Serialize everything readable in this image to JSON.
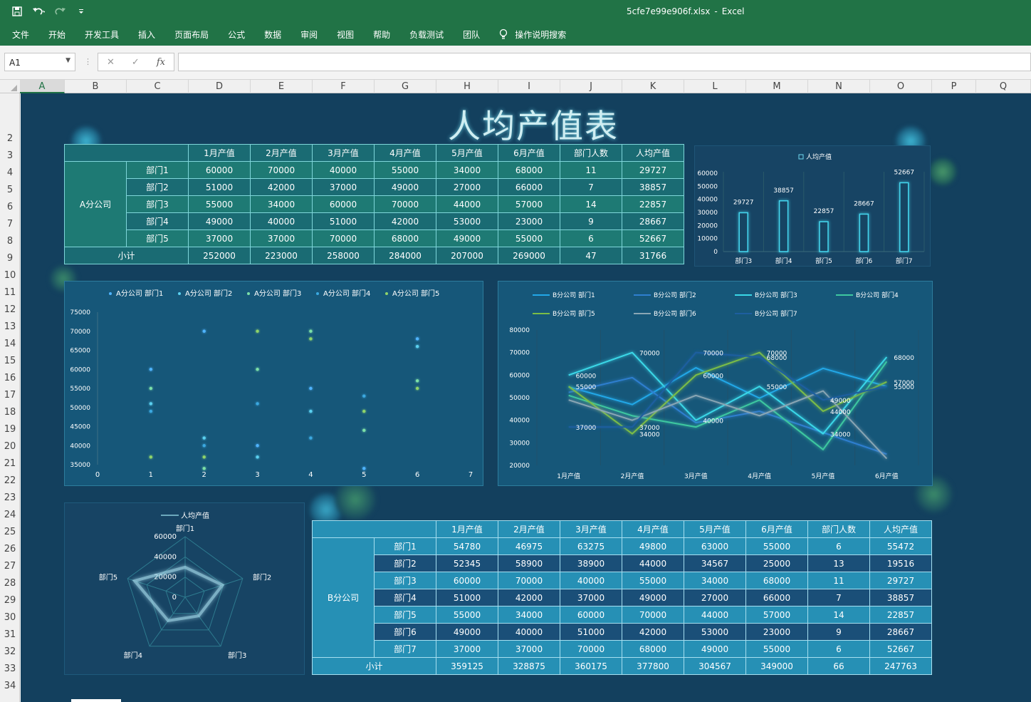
{
  "app": {
    "file": "5cfe7e99e906f.xlsx",
    "sep": "-",
    "name": "Excel"
  },
  "ribbon": [
    "文件",
    "开始",
    "开发工具",
    "插入",
    "页面布局",
    "公式",
    "数据",
    "审阅",
    "视图",
    "帮助",
    "负载测试",
    "团队"
  ],
  "search_label": "操作说明搜索",
  "name_box": "A1",
  "columns": [
    "A",
    "B",
    "C",
    "D",
    "E",
    "F",
    "G",
    "H",
    "I",
    "J",
    "K",
    "L",
    "M",
    "N",
    "O",
    "P",
    "Q"
  ],
  "rows": [
    "2",
    "3",
    "4",
    "5",
    "6",
    "7",
    "8",
    "9",
    "10",
    "11",
    "12",
    "13",
    "14",
    "15",
    "16",
    "17",
    "18",
    "19",
    "20",
    "21",
    "22",
    "23",
    "24",
    "25",
    "26",
    "27",
    "28",
    "29",
    "30",
    "31",
    "32",
    "33",
    "34"
  ],
  "title": "人均产值表",
  "table_a": {
    "headers": [
      "1月产值",
      "2月产值",
      "3月产值",
      "4月产值",
      "5月产值",
      "6月产值",
      "部门人数",
      "人均产值"
    ],
    "group": "A分公司",
    "rows": [
      {
        "dept": "部门1",
        "values": [
          "60000",
          "70000",
          "40000",
          "55000",
          "34000",
          "68000",
          "11",
          "29727"
        ]
      },
      {
        "dept": "部门2",
        "values": [
          "51000",
          "42000",
          "37000",
          "49000",
          "27000",
          "66000",
          "7",
          "38857"
        ]
      },
      {
        "dept": "部门3",
        "values": [
          "55000",
          "34000",
          "60000",
          "70000",
          "44000",
          "57000",
          "14",
          "22857"
        ]
      },
      {
        "dept": "部门4",
        "values": [
          "49000",
          "40000",
          "51000",
          "42000",
          "53000",
          "23000",
          "9",
          "28667"
        ]
      },
      {
        "dept": "部门5",
        "values": [
          "37000",
          "37000",
          "70000",
          "68000",
          "49000",
          "55000",
          "6",
          "52667"
        ]
      }
    ],
    "subtotal_label": "小计",
    "subtotal": [
      "252000",
      "223000",
      "258000",
      "284000",
      "207000",
      "269000",
      "47",
      "31766"
    ]
  },
  "table_b": {
    "headers": [
      "1月产值",
      "2月产值",
      "3月产值",
      "4月产值",
      "5月产值",
      "6月产值",
      "部门人数",
      "人均产值"
    ],
    "group": "B分公司",
    "rows": [
      {
        "dept": "部门1",
        "values": [
          "54780",
          "46975",
          "63275",
          "49800",
          "63000",
          "55000",
          "6",
          "55472"
        ]
      },
      {
        "dept": "部门2",
        "values": [
          "52345",
          "58900",
          "38900",
          "44000",
          "34567",
          "25000",
          "13",
          "19516"
        ]
      },
      {
        "dept": "部门3",
        "values": [
          "60000",
          "70000",
          "40000",
          "55000",
          "34000",
          "68000",
          "11",
          "29727"
        ]
      },
      {
        "dept": "部门4",
        "values": [
          "51000",
          "42000",
          "37000",
          "49000",
          "27000",
          "66000",
          "7",
          "38857"
        ]
      },
      {
        "dept": "部门5",
        "values": [
          "55000",
          "34000",
          "60000",
          "70000",
          "44000",
          "57000",
          "14",
          "22857"
        ]
      },
      {
        "dept": "部门6",
        "values": [
          "49000",
          "40000",
          "51000",
          "42000",
          "53000",
          "23000",
          "9",
          "28667"
        ]
      },
      {
        "dept": "部门7",
        "values": [
          "37000",
          "37000",
          "70000",
          "68000",
          "49000",
          "55000",
          "6",
          "52667"
        ]
      }
    ],
    "subtotal_label": "小计",
    "subtotal": [
      "359125",
      "328875",
      "360175",
      "377800",
      "304567",
      "349000",
      "66",
      "247763"
    ]
  },
  "chart_data": [
    {
      "type": "bar",
      "legend": "人均产值",
      "categories": [
        "部门3",
        "部门4",
        "部门5",
        "部门6",
        "部门7"
      ],
      "values": [
        29727,
        38857,
        22857,
        28667,
        52667
      ],
      "ylim": [
        0,
        60000
      ],
      "yticks": [
        "0",
        "10000",
        "20000",
        "30000",
        "40000",
        "50000",
        "60000"
      ],
      "legend_position": "top"
    },
    {
      "type": "scatter",
      "series": [
        {
          "name": "A分公司 部门1",
          "color": "#4fb4ff",
          "values": [
            60000,
            70000,
            40000,
            55000,
            34000,
            68000
          ]
        },
        {
          "name": "A分公司 部门2",
          "color": "#5ad0f0",
          "values": [
            51000,
            42000,
            37000,
            49000,
            27000,
            66000
          ]
        },
        {
          "name": "A分公司 部门3",
          "color": "#7ce0a8",
          "values": [
            55000,
            34000,
            60000,
            70000,
            44000,
            57000
          ]
        },
        {
          "name": "A分公司 部门4",
          "color": "#3aa8e0",
          "values": [
            49000,
            40000,
            51000,
            42000,
            53000,
            23000
          ]
        },
        {
          "name": "A分公司 部门5",
          "color": "#8fd46a",
          "values": [
            37000,
            37000,
            70000,
            68000,
            49000,
            55000
          ]
        }
      ],
      "xlim": [
        0,
        7
      ],
      "ylim": [
        35000,
        75000
      ],
      "xticks": [
        "0",
        "1",
        "2",
        "3",
        "4",
        "5",
        "6",
        "7"
      ],
      "yticks": [
        "35000",
        "40000",
        "45000",
        "50000",
        "55000",
        "60000",
        "65000",
        "70000",
        "75000"
      ],
      "legend_position": "top"
    },
    {
      "type": "line",
      "categories": [
        "1月产值",
        "2月产值",
        "3月产值",
        "4月产值",
        "5月产值",
        "6月产值"
      ],
      "series": [
        {
          "name": "B分公司 部门1",
          "color": "#22a8e8",
          "values": [
            54780,
            46975,
            63275,
            49800,
            63000,
            55000
          ]
        },
        {
          "name": "B分公司 部门2",
          "color": "#2f7fd0",
          "values": [
            52345,
            58900,
            38900,
            44000,
            34567,
            25000
          ]
        },
        {
          "name": "B分公司 部门3",
          "color": "#3ad8e8",
          "values": [
            60000,
            70000,
            40000,
            55000,
            34000,
            68000
          ]
        },
        {
          "name": "B分公司 部门4",
          "color": "#3ec8a0",
          "values": [
            51000,
            42000,
            37000,
            49000,
            27000,
            66000
          ]
        },
        {
          "name": "B分公司 部门5",
          "color": "#7bbd46",
          "values": [
            55000,
            34000,
            60000,
            70000,
            44000,
            57000
          ]
        },
        {
          "name": "B分公司 部门6",
          "color": "#8aa6b4",
          "values": [
            49000,
            40000,
            51000,
            42000,
            53000,
            23000
          ]
        },
        {
          "name": "B分公司 部门7",
          "color": "#1e5fa0",
          "values": [
            37000,
            37000,
            70000,
            68000,
            49000,
            55000
          ]
        }
      ],
      "ylim": [
        20000,
        80000
      ],
      "yticks": [
        "20000",
        "30000",
        "40000",
        "50000",
        "60000",
        "70000",
        "80000"
      ],
      "data_labels": [
        {
          "x": 0,
          "y": 60000,
          "text": "60000"
        },
        {
          "x": 0,
          "y": 55000,
          "text": "55000"
        },
        {
          "x": 0,
          "y": 37000,
          "text": "37000"
        },
        {
          "x": 1,
          "y": 70000,
          "text": "70000"
        },
        {
          "x": 1,
          "y": 37000,
          "text": "37000"
        },
        {
          "x": 1,
          "y": 34000,
          "text": "34000"
        },
        {
          "x": 2,
          "y": 70000,
          "text": "70000"
        },
        {
          "x": 2,
          "y": 60000,
          "text": "60000"
        },
        {
          "x": 2,
          "y": 40000,
          "text": "40000"
        },
        {
          "x": 3,
          "y": 70000,
          "text": "70000"
        },
        {
          "x": 3,
          "y": 68000,
          "text": "68000"
        },
        {
          "x": 3,
          "y": 55000,
          "text": "55000"
        },
        {
          "x": 4,
          "y": 49000,
          "text": "49000"
        },
        {
          "x": 4,
          "y": 44000,
          "text": "44000"
        },
        {
          "x": 4,
          "y": 34000,
          "text": "34000"
        },
        {
          "x": 5,
          "y": 68000,
          "text": "68000"
        },
        {
          "x": 5,
          "y": 57000,
          "text": "57000"
        },
        {
          "x": 5,
          "y": 55000,
          "text": "55000"
        }
      ],
      "legend_position": "top"
    },
    {
      "type": "radar",
      "legend": "人均产值",
      "categories": [
        "部门1",
        "部门2",
        "部门3",
        "部门4",
        "部门5"
      ],
      "values": [
        29727,
        38857,
        22857,
        28667,
        52667
      ],
      "rmax": 60000,
      "rticks": [
        "0",
        "20000",
        "40000",
        "60000"
      ],
      "legend_position": "top"
    }
  ]
}
